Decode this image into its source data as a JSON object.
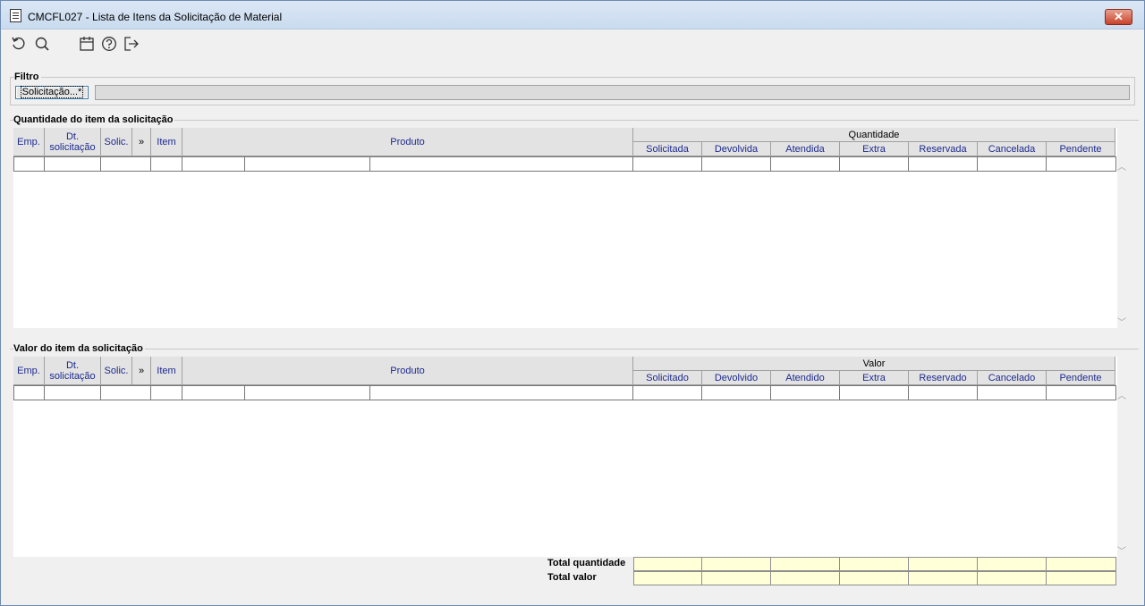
{
  "window": {
    "title": "CMCFL027 - Lista de Itens da Solicitação de Material",
    "close_label": "✕"
  },
  "toolbar": {
    "buttons": [
      {
        "name": "refresh-icon"
      },
      {
        "name": "search-icon"
      },
      {
        "name": "calendar-icon"
      },
      {
        "name": "help-icon"
      },
      {
        "name": "exit-icon"
      }
    ]
  },
  "filter": {
    "label": "Filtro",
    "solicitacao_button": "Solicitação...*",
    "solicitacao_value": ""
  },
  "quantity_section": {
    "label": "Quantidade do item da solicitação",
    "group_header": "Quantidade",
    "columns": [
      "Emp.",
      "Dt. solicitação",
      "Solic.",
      "»",
      "Item",
      "Produto"
    ],
    "sub_columns": [
      "Solicitada",
      "Devolvida",
      "Atendida",
      "Extra",
      "Reservada",
      "Cancelada",
      "Pendente"
    ]
  },
  "value_section": {
    "label": "Valor do item da solicitação",
    "group_header": "Valor",
    "columns": [
      "Emp.",
      "Dt. solicitação",
      "Solic.",
      "»",
      "Item",
      "Produto"
    ],
    "sub_columns": [
      "Solicitado",
      "Devolvido",
      "Atendido",
      "Extra",
      "Reservado",
      "Cancelado",
      "Pendente"
    ]
  },
  "totals": {
    "quantity_label": "Total quantidade",
    "value_label": "Total valor"
  },
  "colors": {
    "header_text": "#1d2a8e",
    "totals_background": "#ffffd8",
    "close_button": "#c8432a"
  }
}
